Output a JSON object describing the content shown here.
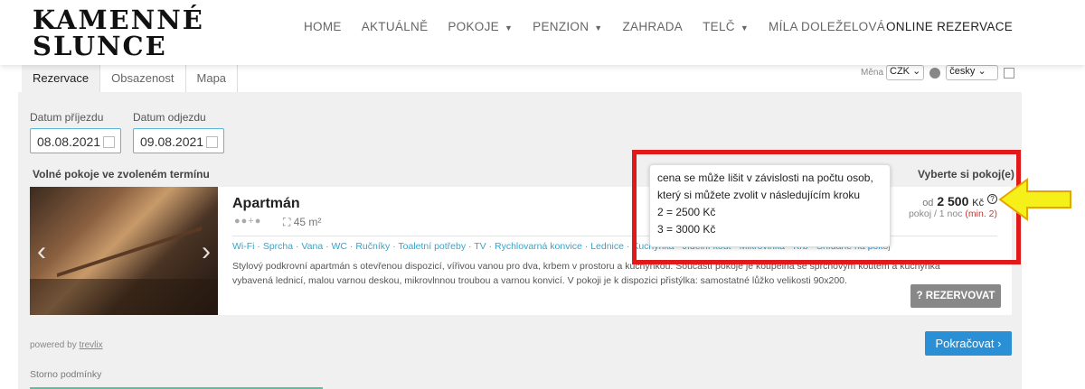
{
  "header": {
    "logo_line1": "KAMENNÉ",
    "logo_line2": "SLUNCE",
    "nav": [
      "HOME",
      "AKTUÁLNĚ",
      "POKOJE",
      "PENZION",
      "ZAHRADA",
      "TELČ",
      "MÍLA DOLEŽELOVÁ"
    ],
    "online": "ONLINE REZERVACE"
  },
  "tabs": [
    "Rezervace",
    "Obsazenost",
    "Mapa"
  ],
  "currency": {
    "label": "Měna",
    "value": "CZK",
    "lang": "česky"
  },
  "dates": {
    "arrival_label": "Datum příjezdu",
    "arrival_value": "08.08.2021",
    "departure_label": "Datum odjezdu",
    "departure_value": "09.08.2021"
  },
  "rooms_title": "Volné pokoje ve zvoleném termínu",
  "select_room": "Vyberte si pokoj(e)",
  "room": {
    "name": "Apartmán",
    "area": "45 m²",
    "amenities": "Wi-Fi · Sprcha · Vana · WC · Ručníky · Toaletní potřeby · TV · Rychlovarná konvice · Lednice · Kuchyňka · Jídelní kout · Mikrovlnka · Krb · Snídaně na pokoj",
    "description": "Stylový podkrovní apartmán s otevřenou dispozicí, vířivou vanou pro dva, krbem v prostoru a kuchyňkou. Součástí pokoje je koupelna se sprchovým koutem a kuchyňka vybavená lednicí, malou varnou deskou, mikrovlnnou troubou a varnou konvicí. V pokoji je k dispozici přistýlka: samostatné lůžko velikosti 90x200.",
    "price_prefix": "od",
    "price": "2 500",
    "price_currency": "Kč",
    "price_sub": "pokoj / 1 noc",
    "price_min": "(min. 2)",
    "reserve_label": "REZERVOVAT"
  },
  "tooltip": {
    "line1": "cena se může lišit v závislosti na počtu osob,",
    "line2": "který si můžete zvolit v následujícím kroku",
    "line3": "2 = 2500 Kč",
    "line4": "3 = 3000 Kč"
  },
  "footer": {
    "powered_prefix": "powered by",
    "powered_link": "trevlix",
    "continue": "Pokračovat",
    "storno": "Storno podmínky"
  }
}
